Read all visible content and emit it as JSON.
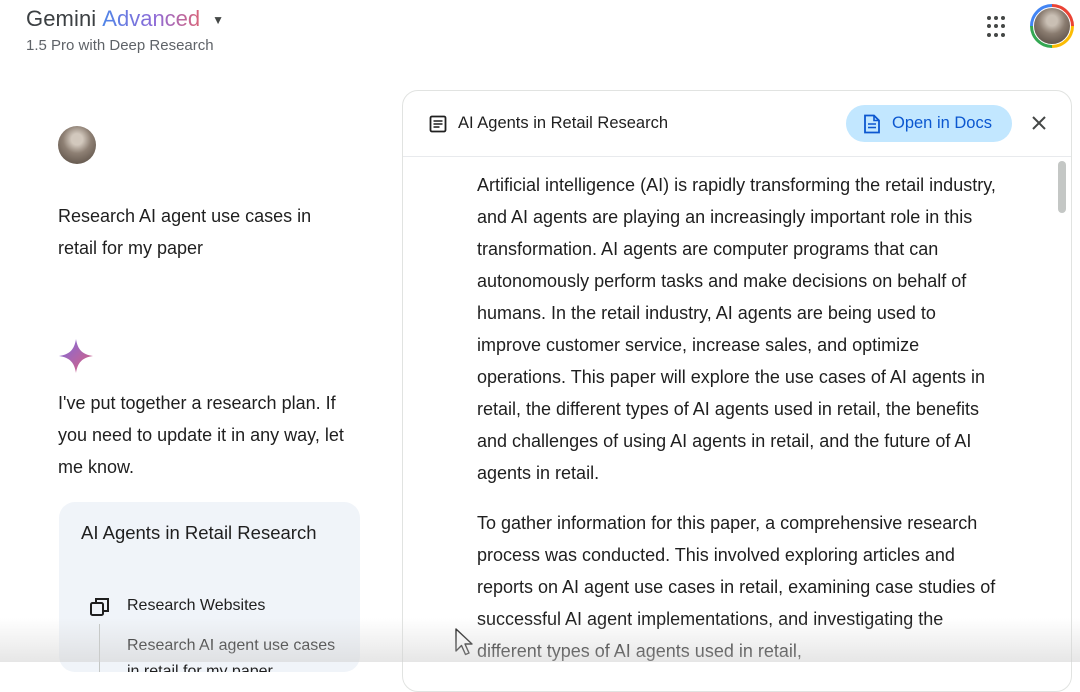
{
  "header": {
    "title_main": "Gemini",
    "title_accent": "Advanced",
    "model_label": "1.5 Pro with Deep Research",
    "caret_icon": "caret-down-icon",
    "apps_icon": "apps-grid-icon",
    "account_icon": "account-avatar"
  },
  "chat": {
    "user_prompt": "Research AI agent use cases in retail for my paper",
    "assistant_icon": "gemini-spark-icon",
    "assistant_message": "I've put together a research plan. If you need to update it in any way, let me know.",
    "plan_card": {
      "title": "AI Agents in Retail Research",
      "step_icon": "research-websites-icon",
      "step_label": "Research Websites",
      "step_description": "Research AI agent use cases in retail for my paper"
    }
  },
  "document": {
    "title": "AI Agents in Retail Research",
    "doc_icon": "document-icon",
    "open_button_label": "Open in Docs",
    "close_icon": "close-icon",
    "paragraphs": [
      "Artificial intelligence (AI) is rapidly transforming the retail industry, and AI agents are playing an increasingly important role in this transformation. AI agents are computer programs that can autonomously perform tasks and make decisions on behalf of humans. In the retail industry, AI agents are being used to improve customer service, increase sales, and optimize operations. This paper will explore the use cases of AI agents in retail, the different types of AI agents used in retail, the benefits and challenges of using AI agents in retail, and the future of AI agents in retail.",
      "To gather information for this paper, a comprehensive research process was conducted. This involved exploring articles and reports on AI agent use cases in retail, examining case studies of successful AI agent implementations, and investigating the different types of AI agents used in retail,"
    ]
  },
  "colors": {
    "accent_blue": "#0b57d0",
    "button_bg": "#c2e7ff",
    "card_bg": "#f0f4f9",
    "spark_start": "#5b7be8",
    "spark_end": "#e0607a"
  }
}
